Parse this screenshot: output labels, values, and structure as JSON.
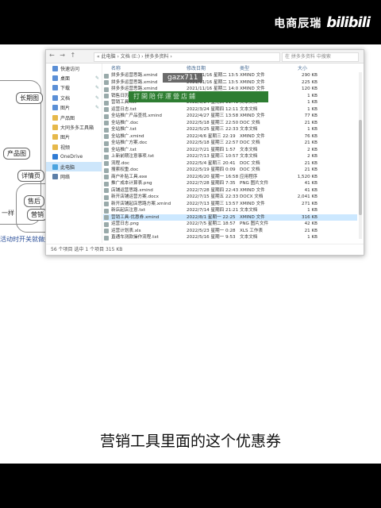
{
  "brand": {
    "name": "电商辰瑞",
    "logo": "bilibili"
  },
  "mindmap": {
    "nodes": [
      "长期图",
      "产品图",
      "详情页",
      "售后",
      "营销"
    ],
    "texts": [
      "活动时开关就做好",
      "一样"
    ]
  },
  "explorer": {
    "path": "« 此电脑 › 文档 (E:) › 拼多多资料 ›",
    "search_placeholder": "在 拼多多资料 中搜索",
    "nav_glyphs": "←  →  ↑",
    "columns": [
      "名称",
      "修改日期",
      "类型",
      "大小"
    ],
    "nav_items": [
      {
        "label": "快速访问",
        "pinned": false
      },
      {
        "label": "桌面",
        "pinned": true
      },
      {
        "label": "下载",
        "pinned": true
      },
      {
        "label": "文档",
        "pinned": true
      },
      {
        "label": "图片",
        "pinned": true
      },
      {
        "label": "产品图",
        "pinned": false
      },
      {
        "label": "大同多多工具箱",
        "pinned": false
      },
      {
        "label": "图片",
        "pinned": false
      },
      {
        "label": "视频",
        "pinned": false
      },
      {
        "label": "OneDrive",
        "pinned": false
      },
      {
        "label": "此电脑",
        "pinned": false,
        "selected": true
      },
      {
        "label": "网络",
        "pinned": false
      }
    ],
    "files": [
      {
        "name": "拼多多运营思路.xmind",
        "date": "2021/11/16 星期二 13:56",
        "type": "XMIND 文件",
        "size": "290 KB"
      },
      {
        "name": "拼多多运营思路.xmind",
        "date": "2021/11/16 星期二 13:51",
        "type": "XMIND 文件",
        "size": "225 KB"
      },
      {
        "name": "拼多多运营思路.xmind",
        "date": "2021/11/16 星期二 14:03",
        "type": "XMIND 文件",
        "size": "120 KB"
      },
      {
        "name": "销售日历.txt",
        "date": "2022/3/24 星期四 11:20",
        "type": "文本文档",
        "size": "1 KB"
      },
      {
        "name": "营销工具.txt",
        "date": "2022/3/24 星期四 11:41",
        "type": "文本文档",
        "size": "1 KB"
      },
      {
        "name": "运营日志.txt",
        "date": "2022/3/24 星期四 12:11",
        "type": "文本文档",
        "size": "1 KB"
      },
      {
        "name": "全站推广产品查找.xmind",
        "date": "2022/4/27 星期三 13:58",
        "type": "XMIND 文件",
        "size": "77 KB"
      },
      {
        "name": "全站推广.doc",
        "date": "2022/5/18 星期三 22:50",
        "type": "DOC 文档",
        "size": "21 KB"
      },
      {
        "name": "全站推广.txt",
        "date": "2022/5/25 星期三 22:33",
        "type": "文本文档",
        "size": "1 KB"
      },
      {
        "name": "全站推广.xmind",
        "date": "2022/4/6 星期三 22:19",
        "type": "XMIND 文件",
        "size": "76 KB"
      },
      {
        "name": "全站推广方案.doc",
        "date": "2022/5/18 星期三 22:57",
        "type": "DOC 文档",
        "size": "21 KB"
      },
      {
        "name": "全站推广.txt",
        "date": "2022/7/21 星期四 1:57",
        "type": "文本文档",
        "size": "2 KB"
      },
      {
        "name": "上新前期注意事项.txt",
        "date": "2022/7/13 星期三 10:57",
        "type": "文本文档",
        "size": "2 KB"
      },
      {
        "name": "流程.doc",
        "date": "2022/5/4 星期三 20:41",
        "type": "DOC 文档",
        "size": "21 KB"
      },
      {
        "name": "搜索权重.doc",
        "date": "2022/5/19 星期四 0:09",
        "type": "DOC 文档",
        "size": "21 KB"
      },
      {
        "name": "商户补贴工具.exe",
        "date": "2022/6/20 星期一 16:58",
        "type": "应用程序",
        "size": "1,520 KB"
      },
      {
        "name": "推广成本计算表.png",
        "date": "2022/7/28 星期四 7:35",
        "type": "PNG 图片文件",
        "size": "41 KB"
      },
      {
        "name": "店铺运营思路.xmind",
        "date": "2022/7/28 星期四 22:43",
        "type": "XMIND 文件",
        "size": "41 KB"
      },
      {
        "name": "新开店铺运营方案.docx",
        "date": "2022/7/15 星期五 22:33",
        "type": "DOCX 文档",
        "size": "2,041 KB"
      },
      {
        "name": "新开店铺起店思路方案.xmind",
        "date": "2022/7/13 星期三 13:57",
        "type": "XMIND 文件",
        "size": "271 KB"
      },
      {
        "name": "新店起店注意.txt",
        "date": "2022/7/14 星期四 21:21",
        "type": "文本文档",
        "size": "1 KB"
      },
      {
        "name": "营销工具-优惠券.xmind",
        "date": "2022/8/1 星期一 22:25",
        "type": "XMIND 文件",
        "size": "316 KB",
        "selected": true
      },
      {
        "name": "运营日志.png",
        "date": "2022/7/5 星期二 18:57",
        "type": "PNG 图片文件",
        "size": "42 KB"
      },
      {
        "name": "运营计划表.xls",
        "date": "2022/5/23 星期一 0:28",
        "type": "XLS 工作表",
        "size": "21 KB"
      },
      {
        "name": "直通车测款操作流程.txt",
        "date": "2022/5/16 星期一 9:53",
        "type": "文本文档",
        "size": "1 KB"
      }
    ],
    "status": "56 个项目   选中 1 个项目  315 KB"
  },
  "watermark": "gazx711",
  "blurred_banner": "打開陪伴運營店鋪",
  "caption": "营销工具里面的这个优惠券"
}
